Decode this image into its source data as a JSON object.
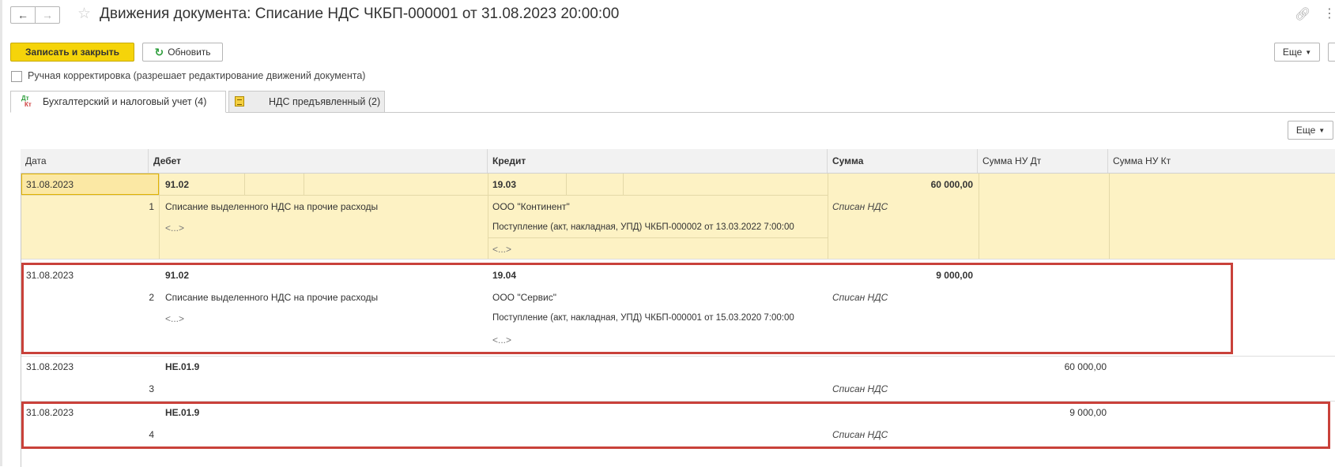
{
  "window": {
    "title": "Движения документа: Списание НДС ЧКБП-000001 от 31.08.2023 20:00:00"
  },
  "icons": {
    "back": "arrow-left-icon",
    "forward": "arrow-right-icon",
    "favorite": "star-icon",
    "link": "link-icon",
    "more": "more-vertical-icon",
    "refresh": "refresh-icon",
    "dt_kt_text_top": "Дт",
    "dt_kt_text_bottom": "Кт"
  },
  "toolbar": {
    "save_close_label": "Записать и закрыть",
    "refresh_label": "Обновить",
    "more_label": "Еще"
  },
  "manual_correction": {
    "label": "Ручная корректировка (разрешает редактирование движений документа)",
    "checked": false
  },
  "tabs": [
    {
      "label": "Бухгалтерский и налоговый учет (4)",
      "active": true
    },
    {
      "label": "НДС предъявленный (2)",
      "active": false
    }
  ],
  "table": {
    "more_label": "Еще",
    "columns": [
      "Дата",
      "Дебет",
      "Кредит",
      "Сумма",
      "Сумма НУ Дт",
      "Сумма НУ Кт"
    ],
    "rows": [
      {
        "date": "31.08.2023",
        "num": "1",
        "debit_account": "91.02",
        "debit_sub1": "Списание выделенного НДС на прочие расходы",
        "debit_sub2": "<...>",
        "credit_account": "19.03",
        "credit_sub1": "ООО \"Континент\"",
        "credit_sub2": "Поступление (акт, накладная, УПД) ЧКБП-000002 от 13.03.2022 7:00:00",
        "credit_sub3": "<...>",
        "sum": "60 000,00",
        "content": "Списан НДС",
        "sum_nu_dt": "",
        "sum_nu_kt": ""
      },
      {
        "date": "31.08.2023",
        "num": "2",
        "debit_account": "91.02",
        "debit_sub1": "Списание выделенного НДС на прочие расходы",
        "debit_sub2": "<...>",
        "credit_account": "19.04",
        "credit_sub1": "ООО \"Сервис\"",
        "credit_sub2": "Поступление (акт, накладная, УПД) ЧКБП-000001 от 15.03.2020 7:00:00",
        "credit_sub3": "<...>",
        "sum": "9 000,00",
        "content": "Списан НДС",
        "sum_nu_dt": "",
        "sum_nu_kt": ""
      },
      {
        "date": "31.08.2023",
        "num": "3",
        "debit_account": "НЕ.01.9",
        "content": "Списан НДС",
        "sum": "",
        "sum_nu_dt": "60 000,00",
        "sum_nu_kt": ""
      },
      {
        "date": "31.08.2023",
        "num": "4",
        "debit_account": "НЕ.01.9",
        "content": "Списан НДС",
        "sum": "",
        "sum_nu_dt": "9 000,00",
        "sum_nu_kt": ""
      }
    ]
  },
  "colors": {
    "accent_yellow": "#f5d40a",
    "selected_row": "#fdf2c4",
    "highlight_frame": "#c9413a"
  }
}
